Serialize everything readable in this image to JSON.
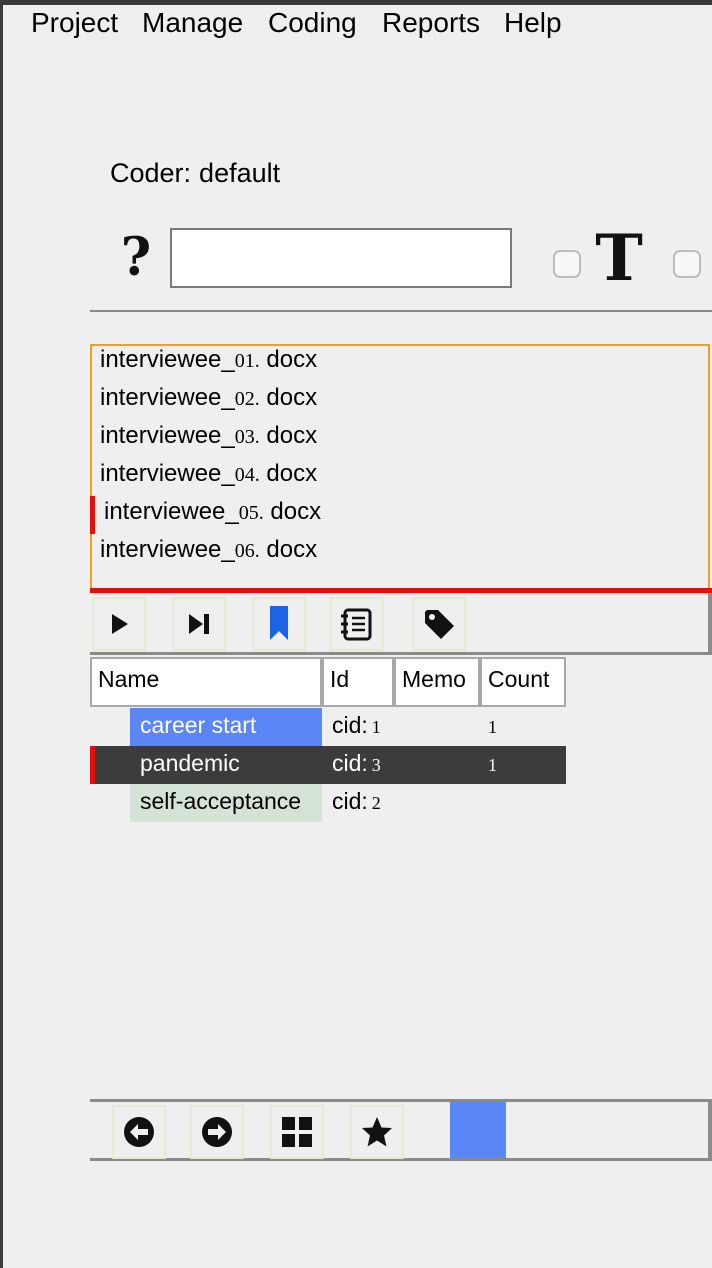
{
  "menu": {
    "items": [
      {
        "label": "Project"
      },
      {
        "label": "Manage"
      },
      {
        "label": "Coding"
      },
      {
        "label": "Reports"
      },
      {
        "label": "Help"
      }
    ]
  },
  "coder": {
    "label": "Coder:",
    "value": "default"
  },
  "search": {
    "help_glyph": "?",
    "value": "",
    "text_glyph": "T"
  },
  "files": [
    {
      "stem": "interviewee_",
      "num": "01.",
      "ext": " docx",
      "selected": false
    },
    {
      "stem": "interviewee_",
      "num": "02.",
      "ext": " docx",
      "selected": false
    },
    {
      "stem": "interviewee_",
      "num": "03.",
      "ext": " docx",
      "selected": false
    },
    {
      "stem": "interviewee_",
      "num": "04.",
      "ext": " docx",
      "selected": false
    },
    {
      "stem": "interviewee_",
      "num": "05.",
      "ext": " docx",
      "selected": true
    },
    {
      "stem": "interviewee_",
      "num": "06.",
      "ext": " docx",
      "selected": false
    }
  ],
  "toolbar": {
    "icons": [
      "play-icon",
      "skip-next-icon",
      "bookmark-icon",
      "notebook-icon",
      "tag-icon"
    ],
    "bookmark_color": "#1e63e6"
  },
  "codes_table": {
    "columns": [
      "Name",
      "Id",
      "Memo",
      "Count"
    ],
    "rows": [
      {
        "name": "career start",
        "id_label": "cid:",
        "id_num": "1",
        "memo": "",
        "count": "1",
        "color": "#5b86f5",
        "text_color": "#ffffff"
      },
      {
        "name": "pandemic",
        "id_label": "cid:",
        "id_num": "3",
        "memo": "",
        "count": "1",
        "color": "#3c3c3c",
        "text_color": "#ffffff",
        "selected": true
      },
      {
        "name": "self-acceptance",
        "id_label": "cid:",
        "id_num": "2",
        "memo": "",
        "count": "",
        "color": "#d5e2d6",
        "text_color": "#000000"
      }
    ]
  },
  "bottom_toolbar": {
    "icons": [
      "arrow-left-circle-icon",
      "arrow-right-circle-icon",
      "grid-icon",
      "star-icon"
    ],
    "swatch_color": "#5b86f5"
  },
  "colors": {
    "accent_orange": "#f0a020",
    "marker_red": "#e01010"
  }
}
